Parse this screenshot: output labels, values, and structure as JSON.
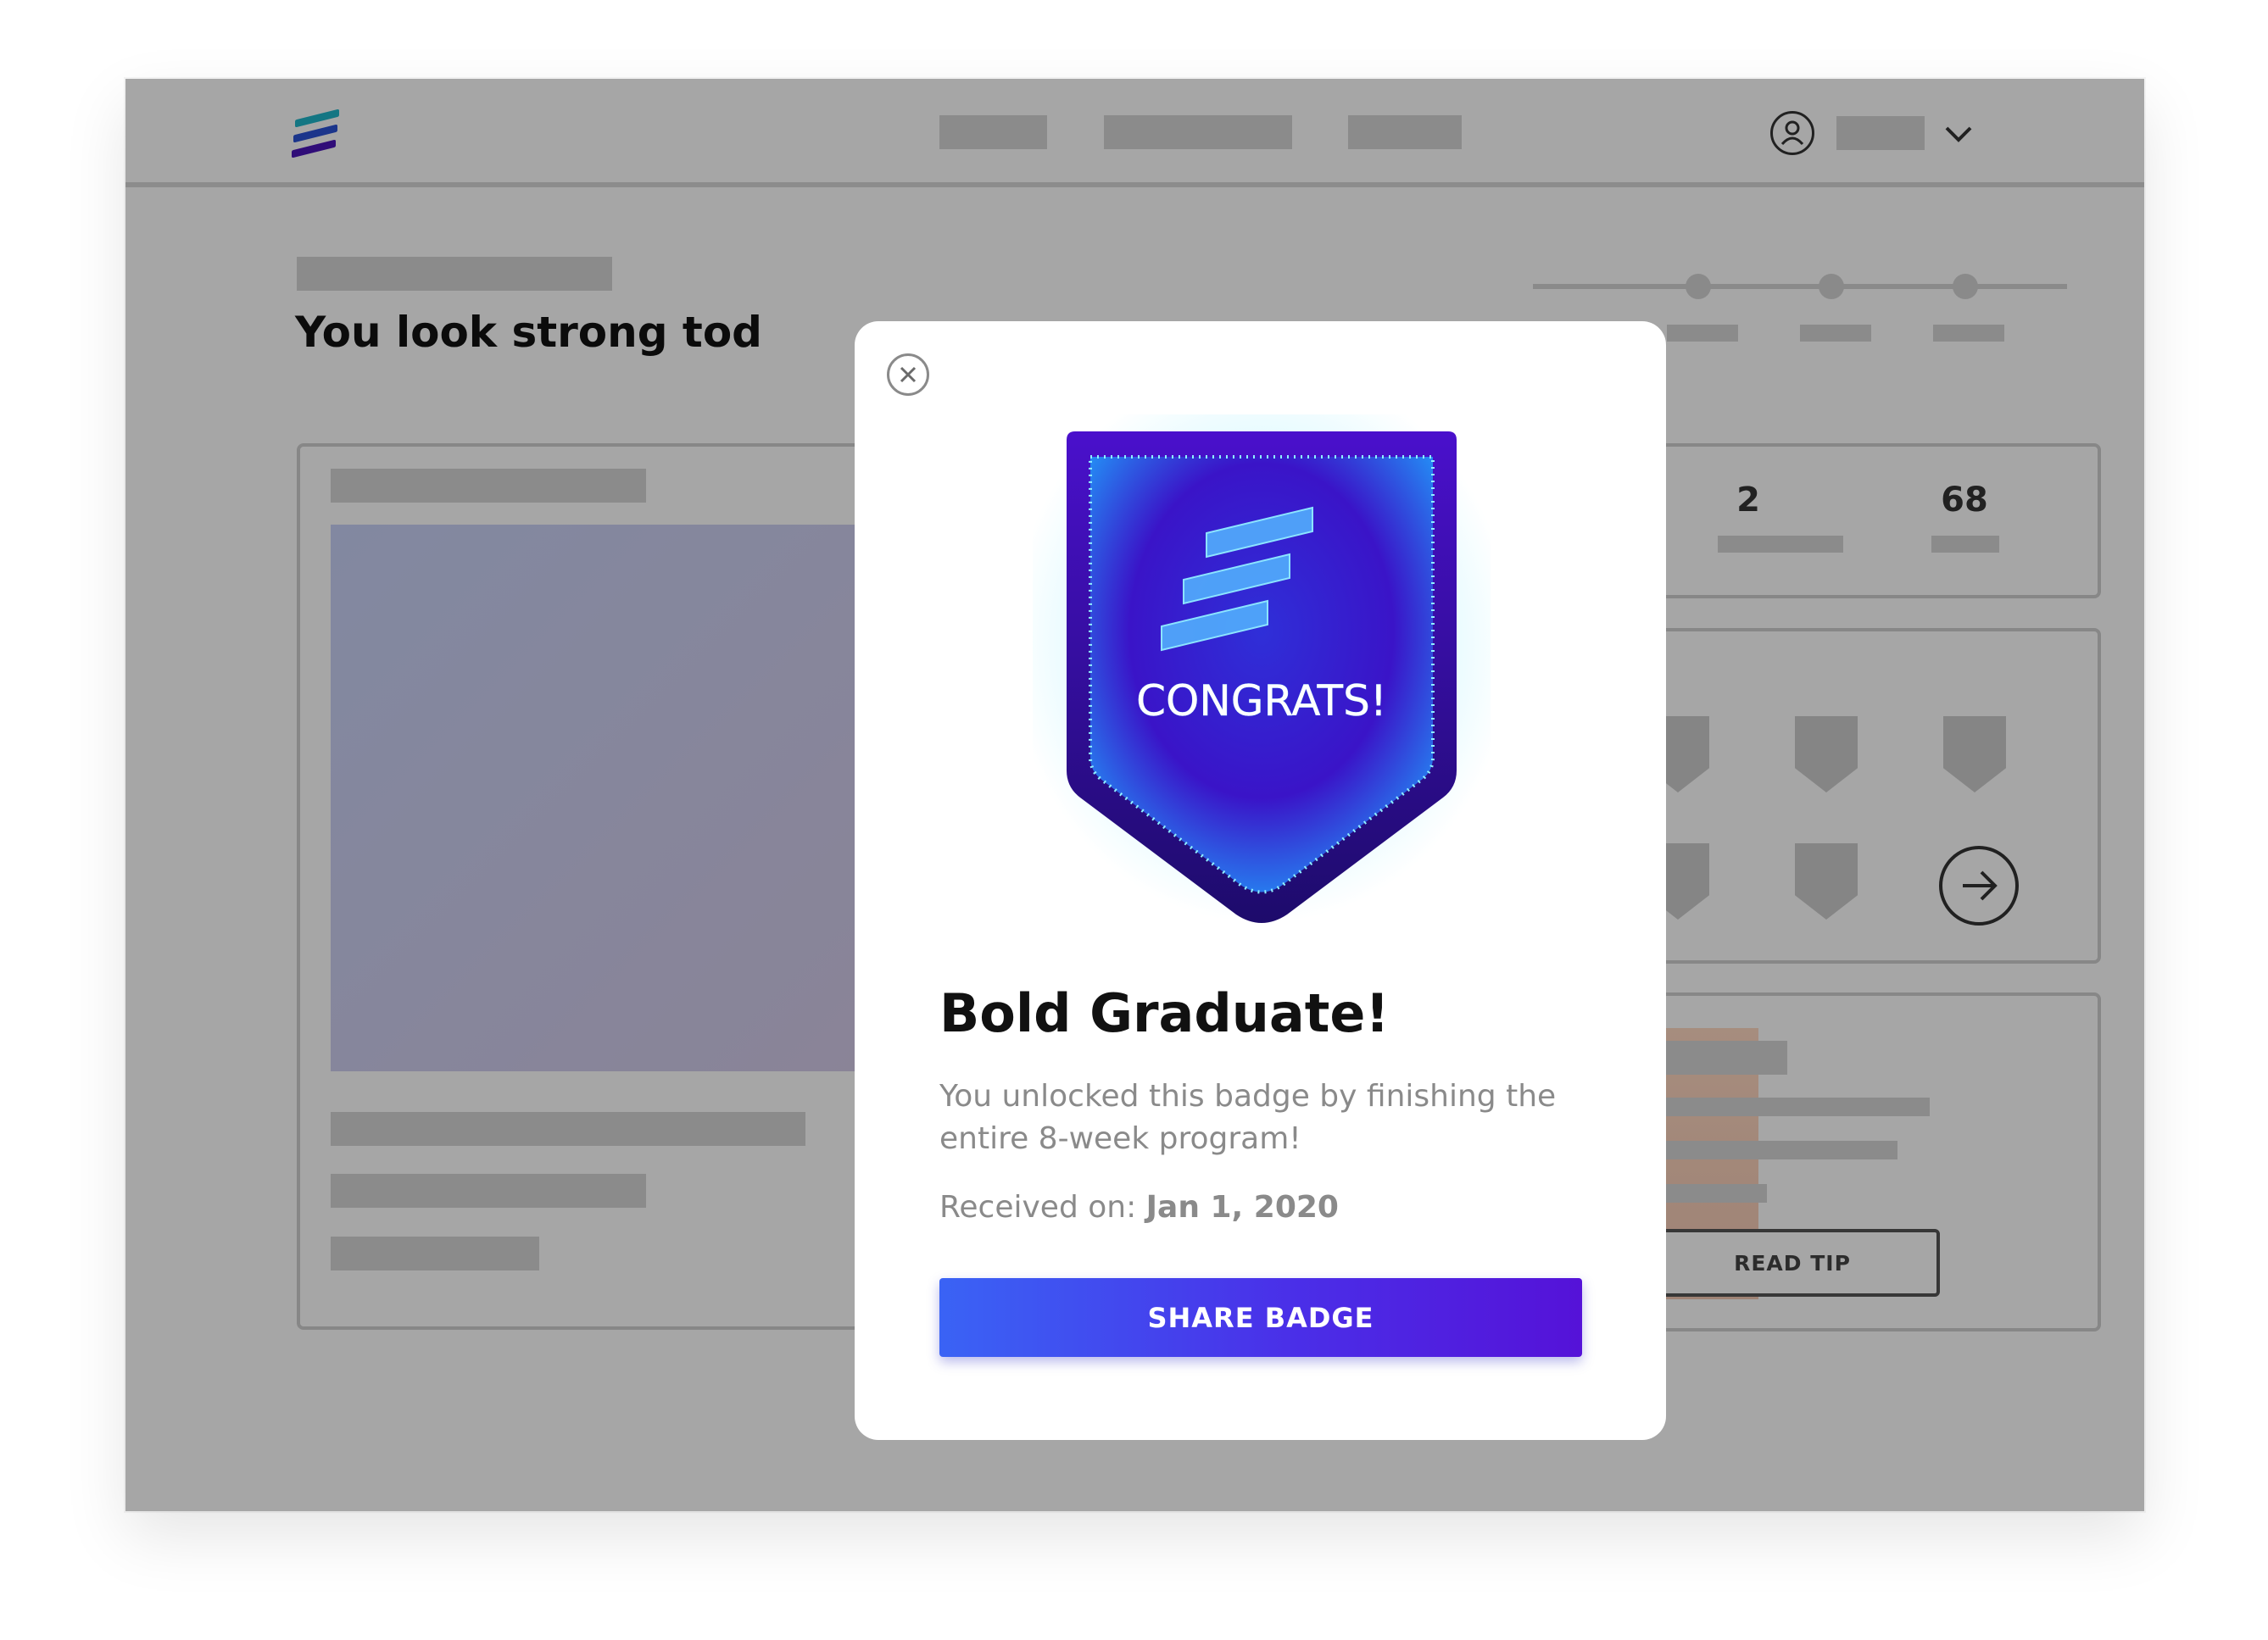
{
  "background": {
    "greeting": "You look strong tod",
    "stats": [
      "2",
      "68"
    ],
    "read_tip_label": "READ TIP"
  },
  "modal": {
    "badge_text": "CONGRATS!",
    "title": "Bold Graduate!",
    "description": "You unlocked this badge by finishing the entire 8-week program!",
    "received_label": "Received on:",
    "received_date": "Jan 1, 2020",
    "share_button_label": "SHARE BADGE"
  },
  "icons": {
    "close": "close-icon",
    "user": "user-icon",
    "chevron": "chevron-down-icon",
    "arrow": "arrow-right-icon"
  },
  "colors": {
    "accent": "#4a2fe8",
    "badge_glow": "#3fd0ff",
    "badge_fill": "#3a0fc9"
  }
}
